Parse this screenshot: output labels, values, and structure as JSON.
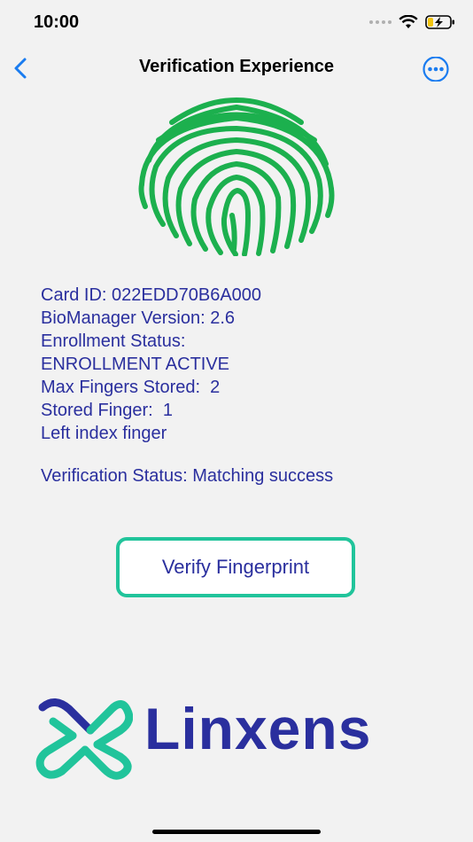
{
  "status_bar": {
    "time": "10:00"
  },
  "nav": {
    "title": "Verification Experience"
  },
  "info": {
    "card_id": "Card ID: 022EDD70B6A000",
    "biomanager_version": "BioManager Version: 2.6",
    "enrollment_status_label": "Enrollment Status:",
    "enrollment_status_value": "ENROLLMENT ACTIVE",
    "max_fingers": "Max Fingers Stored:  2",
    "stored_finger": "Stored Finger:  1",
    "finger_name": "Left index finger",
    "verification_status": "Verification Status: Matching success"
  },
  "button": {
    "verify_label": "Verify Fingerprint"
  },
  "logo": {
    "text": "Linxens"
  },
  "colors": {
    "accent_blue": "#2a2f9e",
    "ios_blue": "#1a7cf0",
    "fingerprint_green": "#1cb04e",
    "button_border": "#21c49b"
  }
}
